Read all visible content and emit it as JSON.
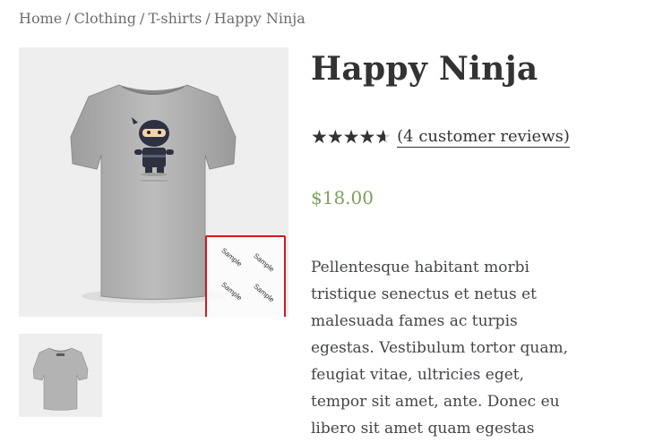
{
  "breadcrumb": {
    "items": [
      "Home",
      "Clothing",
      "T-shirts"
    ],
    "current": "Happy Ninja",
    "separator": "/"
  },
  "gallery": {
    "watermark_text": "Sample",
    "watermark_box_color": "#d0191f"
  },
  "product": {
    "title": "Happy Ninja",
    "rating": {
      "stars": "★★★★★",
      "value_fraction": 0.93,
      "reviews_label": "(4 customer reviews)"
    },
    "price": "$18.00",
    "price_color": "#7f9f5f",
    "description": "Pellentesque habitant morbi tristique senectus et netus et malesuada fames ac turpis egestas. Vestibulum tortor quam, feugiat vitae, ultricies eget, tempor sit amet, ante. Donec eu libero sit amet quam egestas"
  }
}
